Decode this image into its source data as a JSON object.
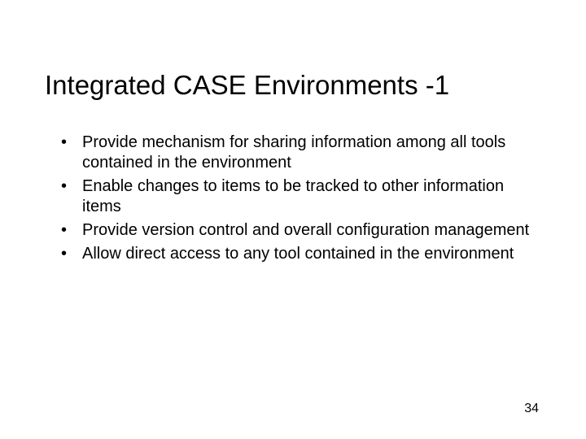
{
  "slide": {
    "title": "Integrated CASE Environments -1",
    "bullets": [
      "Provide mechanism for sharing information among all tools contained in the environment",
      "Enable changes to items to be tracked to other information items",
      "Provide version control and overall configuration management",
      "Allow direct access to any tool contained in the environment"
    ],
    "page_number": "34"
  }
}
